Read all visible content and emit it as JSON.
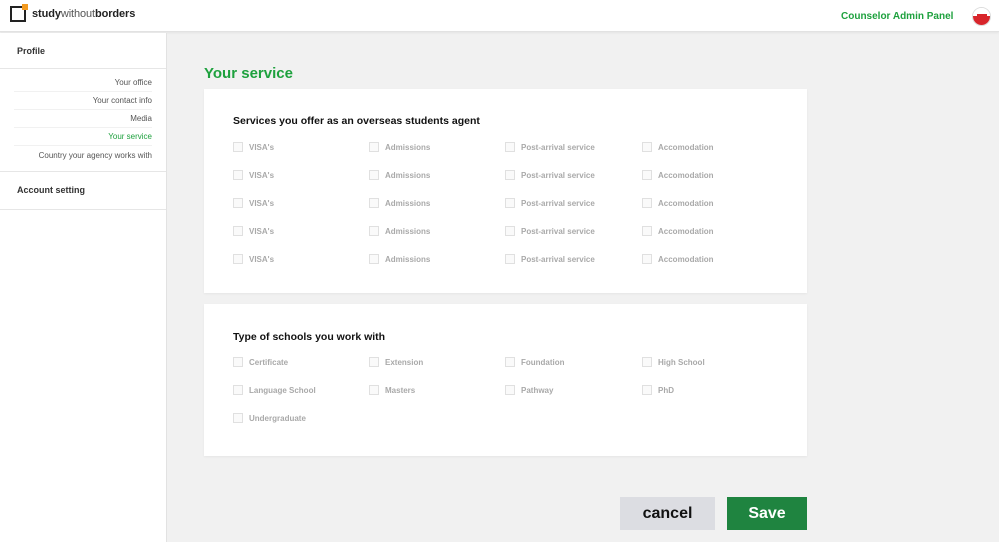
{
  "header": {
    "logo_study": "study",
    "logo_without": "without",
    "logo_borders": "borders",
    "panel_title": "Counselor Admin Panel"
  },
  "sidebar": {
    "profile_heading": "Profile",
    "items": [
      {
        "label": "Your office",
        "active": false
      },
      {
        "label": "Your contact info",
        "active": false
      },
      {
        "label": "Media",
        "active": false
      },
      {
        "label": "Your service",
        "active": true
      },
      {
        "label": "Country your agency works with",
        "active": false
      }
    ],
    "account_heading": "Account setting"
  },
  "main": {
    "title": "Your service",
    "services": {
      "title": "Services you offer as an overseas students agent",
      "rows": [
        [
          "VISA's",
          "Admissions",
          "Post-arrival service",
          "Accomodation"
        ],
        [
          "VISA's",
          "Admissions",
          "Post-arrival service",
          "Accomodation"
        ],
        [
          "VISA's",
          "Admissions",
          "Post-arrival service",
          "Accomodation"
        ],
        [
          "VISA's",
          "Admissions",
          "Post-arrival service",
          "Accomodation"
        ],
        [
          "VISA's",
          "Admissions",
          "Post-arrival service",
          "Accomodation"
        ]
      ]
    },
    "schools": {
      "title": "Type of schools you work with",
      "rows": [
        [
          "Certificate",
          "Extension",
          "Foundation",
          "High School"
        ],
        [
          "Language School",
          "Masters",
          "Pathway",
          "PhD"
        ],
        [
          "Undergraduate"
        ]
      ]
    }
  },
  "actions": {
    "cancel": "cancel",
    "save": "Save"
  },
  "colors": {
    "accent_green": "#1ea13e",
    "save_button": "#1f8440",
    "logo_orange": "#f39a1f"
  }
}
